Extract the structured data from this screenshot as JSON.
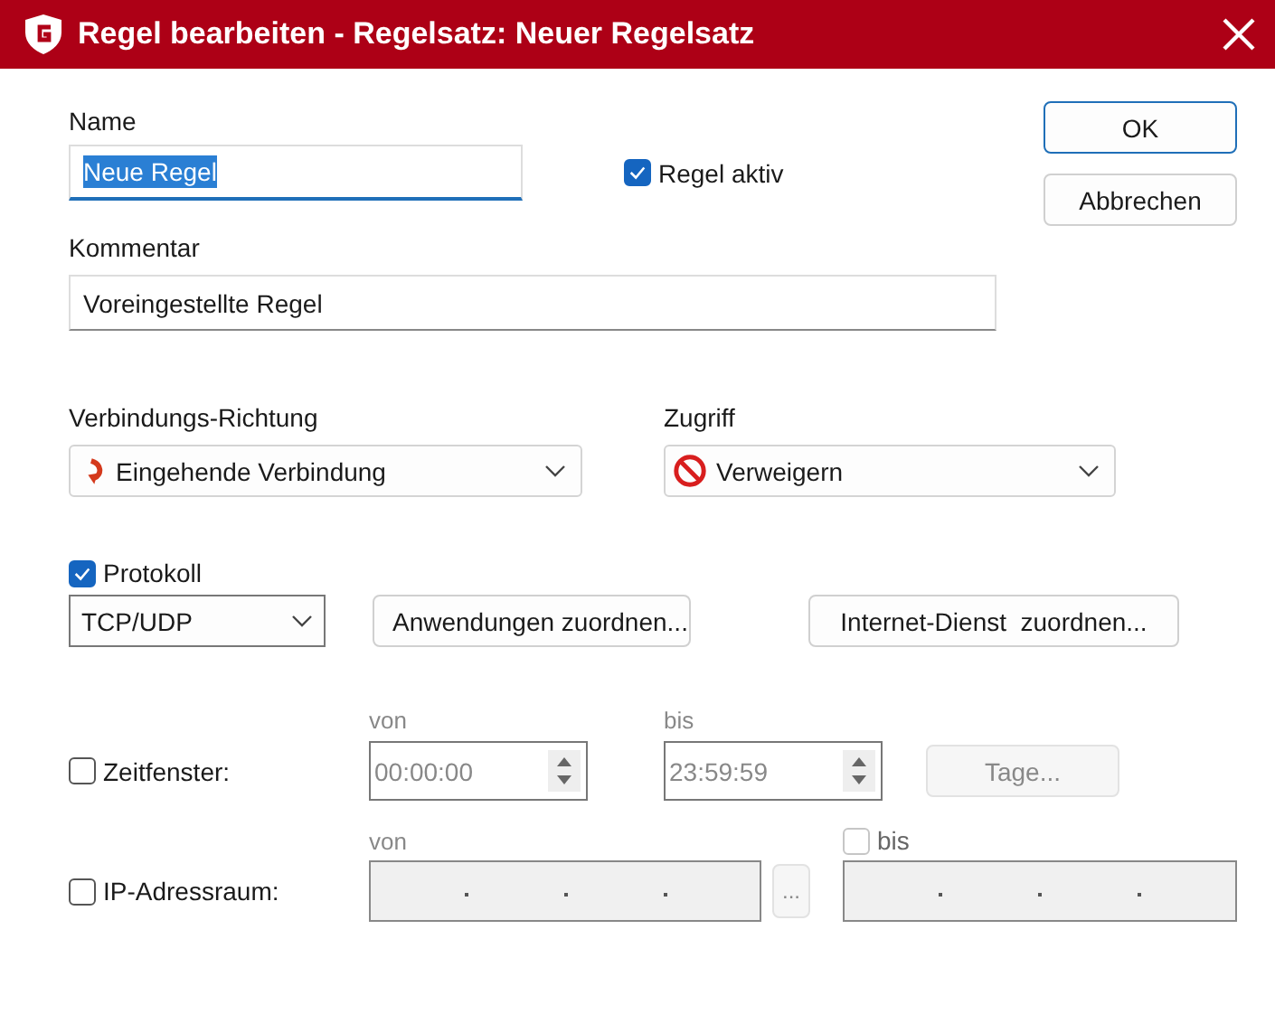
{
  "window": {
    "title": "Regel bearbeiten - Regelsatz: Neuer Regelsatz"
  },
  "name": {
    "label": "Name",
    "value": "Neue Regel",
    "value_selected": true
  },
  "rule_active": {
    "label": "Regel aktiv",
    "checked": true
  },
  "buttons": [
    {
      "label": "OK",
      "default": true
    },
    {
      "label": "Abbrechen",
      "default": false
    }
  ],
  "comment": {
    "label": "Kommentar",
    "value": "Voreingestellte Regel"
  },
  "direction": {
    "label": "Verbindungs-Richtung",
    "value": "Eingehende Verbindung"
  },
  "access": {
    "label": "Zugriff",
    "value": "Verweigern"
  },
  "protocol": {
    "label": "Protokoll",
    "checked": true,
    "value": "TCP/UDP"
  },
  "assign_buttons": [
    {
      "label": "Anwendungen zuordnen..."
    },
    {
      "label": "Internet-Dienst  zuordnen..."
    }
  ],
  "time_window": {
    "label": "Zeitfenster:",
    "checked": false,
    "from_label": "von",
    "from": "00:00:00",
    "to_label": "bis",
    "to": "23:59:59",
    "days_button": "Tage..."
  },
  "ip_range": {
    "label": "IP-Adressraum:",
    "checked": false,
    "from_label": "von",
    "browse_button": "...",
    "to_label": "bis",
    "to_checked": false
  }
}
